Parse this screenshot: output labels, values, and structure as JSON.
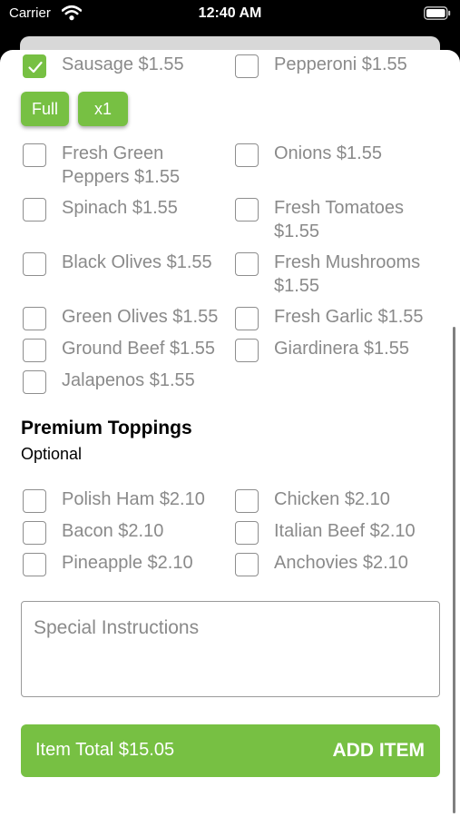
{
  "status_bar": {
    "carrier": "Carrier",
    "time": "12:40 AM"
  },
  "toppings_top": [
    {
      "label": "Sausage $1.55",
      "checked": true
    },
    {
      "label": "Pepperoni $1.55",
      "checked": false
    }
  ],
  "chips": {
    "portion": "Full",
    "quantity": "x1"
  },
  "toppings": [
    {
      "label": "Fresh Green Peppers $1.55",
      "checked": false
    },
    {
      "label": "Onions $1.55",
      "checked": false
    },
    {
      "label": "Spinach $1.55",
      "checked": false
    },
    {
      "label": "Fresh Tomatoes $1.55",
      "checked": false
    },
    {
      "label": "Black Olives $1.55",
      "checked": false
    },
    {
      "label": "Fresh Mushrooms $1.55",
      "checked": false
    },
    {
      "label": "Green Olives $1.55",
      "checked": false
    },
    {
      "label": "Fresh Garlic $1.55",
      "checked": false
    },
    {
      "label": "Ground Beef $1.55",
      "checked": false
    },
    {
      "label": "Giardinera $1.55",
      "checked": false
    },
    {
      "label": "Jalapenos $1.55",
      "checked": false
    }
  ],
  "premium": {
    "title": "Premium Toppings",
    "subtitle": "Optional",
    "items": [
      {
        "label": "Polish Ham $2.10",
        "checked": false
      },
      {
        "label": "Chicken $2.10",
        "checked": false
      },
      {
        "label": "Bacon $2.10",
        "checked": false
      },
      {
        "label": "Italian Beef $2.10",
        "checked": false
      },
      {
        "label": "Pineapple $2.10",
        "checked": false
      },
      {
        "label": "Anchovies $2.10",
        "checked": false
      }
    ]
  },
  "instructions": {
    "placeholder": "Special Instructions"
  },
  "footer": {
    "total": "Item Total $15.05",
    "add_label": "ADD ITEM"
  },
  "colors": {
    "accent": "#77c043",
    "muted_text": "#8a8a8a"
  }
}
